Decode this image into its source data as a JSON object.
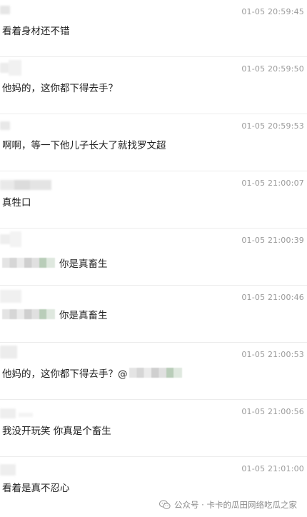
{
  "comments": [
    {
      "timestamp": "01-05 20:59:45",
      "text": "看着身材还不错"
    },
    {
      "timestamp": "01-05 20:59:50",
      "text": "他妈的，这你都下得去手？"
    },
    {
      "timestamp": "01-05 20:59:53",
      "text": "啊啊，等一下他儿子长大了就找罗文超"
    },
    {
      "timestamp": "01-05 21:00:07",
      "text": "真牲口"
    },
    {
      "timestamp": "01-05 21:00:39",
      "text": "你是真畜生"
    },
    {
      "timestamp": "01-05 21:00:46",
      "text": "你是真畜生"
    },
    {
      "timestamp": "01-05 21:00:53",
      "text": "他妈的，这你都下得去手？@"
    },
    {
      "timestamp": "01-05 21:00:56",
      "text": "我没开玩笑 你真是个畜生"
    },
    {
      "timestamp": "01-05 21:01:00",
      "text": "看着是真不忍心"
    }
  ],
  "footer": {
    "text": "公众号 · 卡卡的瓜田网络吃瓜之家",
    "icon": "wechat-icon"
  }
}
